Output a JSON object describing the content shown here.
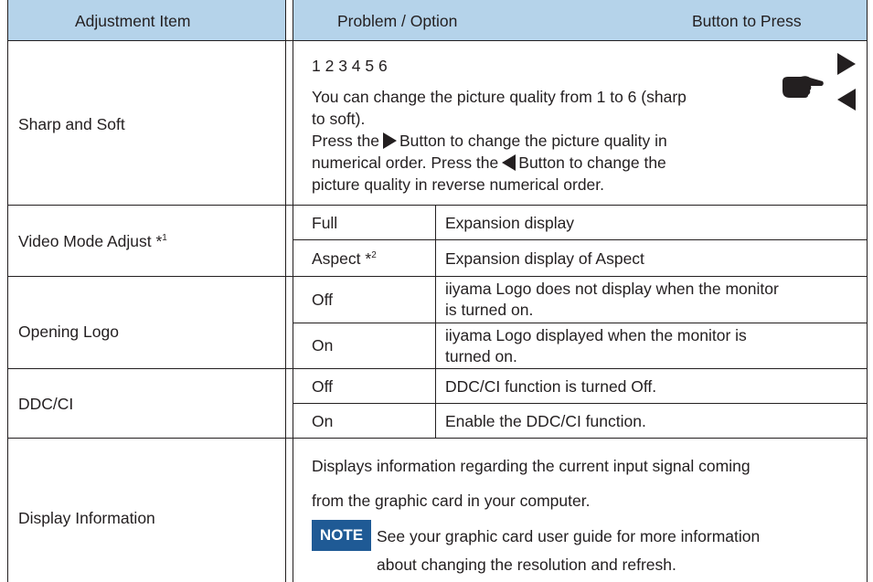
{
  "header": {
    "col1": "Adjustment Item",
    "col2": "Problem / Option",
    "col3": "Button to Press"
  },
  "rows": {
    "sharp": {
      "item": "Sharp and Soft",
      "levels": "1 2 3 4 5 6",
      "desc_1a": "You can change the picture quality from 1 to 6 (sharp",
      "desc_1b": "to soft).",
      "desc_2a": "Press the",
      "desc_2b": "Button to change the picture quality in",
      "desc_3a": "numerical order. Press the",
      "desc_3b": "Button to change the",
      "desc_4": "picture quality in reverse numerical order."
    },
    "video": {
      "item": "Video Mode Adjust *",
      "item_sup": "1",
      "opt1": "Full",
      "opt1_desc": "Expansion display",
      "opt2": "Aspect *",
      "opt2_sup": "2",
      "opt2_desc": "Expansion display of Aspect"
    },
    "logo": {
      "item": "Opening Logo",
      "opt1": "Off",
      "opt1_desc_a": "iiyama Logo does not display when the monitor",
      "opt1_desc_b": "is turned on.",
      "opt2": "On",
      "opt2_desc_a": "iiyama Logo displayed when the monitor is",
      "opt2_desc_b": "turned on."
    },
    "ddc": {
      "item": "DDC/CI",
      "opt1": "Off",
      "opt1_desc": "DDC/CI function is turned Off.",
      "opt2": "On",
      "opt2_desc": "Enable the DDC/CI function."
    },
    "info": {
      "item": "Display Information",
      "desc_a": "Displays information regarding the current input signal coming",
      "desc_b": "from the graphic card in your computer.",
      "note_label": "NOTE",
      "note_a": "See your graphic card user guide for more information",
      "note_b": "about changing the resolution and refresh."
    }
  },
  "icons": {
    "pointing_hand": "pointing-hand-icon",
    "right_button": "right-triangle-icon",
    "left_button": "left-triangle-icon"
  },
  "colors": {
    "header_bg": "#b5d3ea",
    "note_bg": "#1f5a95",
    "text": "#231f20"
  }
}
